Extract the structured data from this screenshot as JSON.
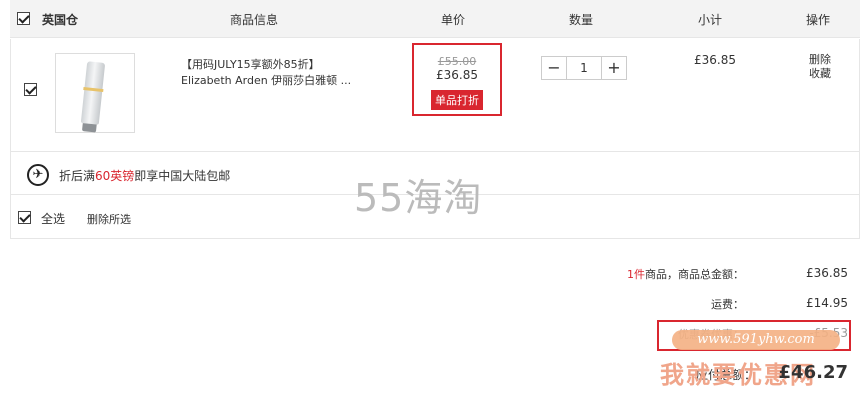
{
  "header": {
    "warehouse": "英国仓",
    "col_product": "商品信息",
    "col_price": "单价",
    "col_qty": "数量",
    "col_subtotal": "小计",
    "col_ops": "操作"
  },
  "item": {
    "name_line1": "【用码JULY15享额外85折】",
    "name_line2": "Elizabeth Arden 伊丽莎白雅顿 ...",
    "original_price": "£55.00",
    "price": "£36.85",
    "discount_tag": "单品打折",
    "qty_minus": "−",
    "quantity": "1",
    "qty_plus": "+",
    "subtotal": "£36.85",
    "op_delete": "删除",
    "op_favorite": "收藏"
  },
  "notice": {
    "icon": "airplane-icon",
    "pre": "折后满",
    "amount": "60英镑",
    "post": "即享中国大陆包邮"
  },
  "watermark": "55海淘",
  "select_all": {
    "label": "全选",
    "delete_selected": "删除所选"
  },
  "summary": {
    "count": "1件",
    "goods_total_label": "商品，商品总金额：",
    "goods_total": "£36.85",
    "shipping_label": "运费：",
    "shipping": "£14.95",
    "coupon_label": "优惠券优惠：",
    "coupon": "-£5.53",
    "payable_label": "应付总额：",
    "payable": "£46.27"
  },
  "watermark_url": "www.591yhw.com",
  "watermark_slogan": "我就要优惠网",
  "colors": {
    "accent": "#d9262f",
    "header_bg": "#f3f3f3"
  }
}
